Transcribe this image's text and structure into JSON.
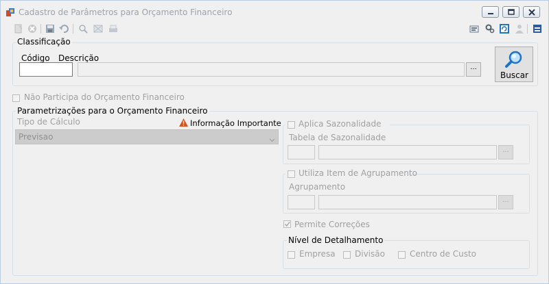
{
  "window": {
    "title": "Cadastro de Parâmetros para Orçamento Financeiro",
    "icon": "form-app-icon",
    "controls": [
      "minimize-icon",
      "maximize-icon",
      "close-icon"
    ]
  },
  "toolbar": {
    "left_icons": [
      "new-icon",
      "delete-icon",
      "save-icon",
      "undo-icon",
      "zoom-icon",
      "find-icon",
      "print-icon"
    ],
    "right_icons": [
      "report-icon",
      "settings-icon",
      "refresh-icon",
      "user-icon",
      "panel-icon"
    ]
  },
  "classificacao": {
    "title": "Classificação",
    "codigo_label": "Código",
    "descricao_label": "Descrição",
    "codigo_value": "",
    "descricao_value": "",
    "lookup_label": "...",
    "buscar_label": "Buscar"
  },
  "nao_participa": {
    "label": "Não Participa do Orçamento Financeiro",
    "checked": false
  },
  "parametrizacoes": {
    "title": "Parametrizações para o Orçamento Financeiro",
    "tipo_calculo_label": "Tipo de Cálculo",
    "info_label": "Informação Importante",
    "tipo_calculo_value": "Previsao",
    "aplica_sazonalidade": {
      "label": "Aplica Sazonalidade",
      "checked": false,
      "tabela_label": "Tabela de Sazonalidade",
      "lookup_label": "..."
    },
    "utiliza_agrupamento": {
      "label": "Utiliza Item de Agrupamento",
      "checked": false,
      "agrupamento_label": "Agrupamento",
      "lookup_label": "..."
    },
    "permite_correcoes": {
      "label": "Permite Correções",
      "checked": true
    },
    "nivel_detalhamento": {
      "title": "Nível de Detalhamento",
      "options": [
        "Empresa",
        "Divisão",
        "Centro de Custo"
      ]
    }
  },
  "colors": {
    "accent": "#1e73c8",
    "warning": "#d9531e",
    "disabled_text": "#a0a0a0"
  }
}
